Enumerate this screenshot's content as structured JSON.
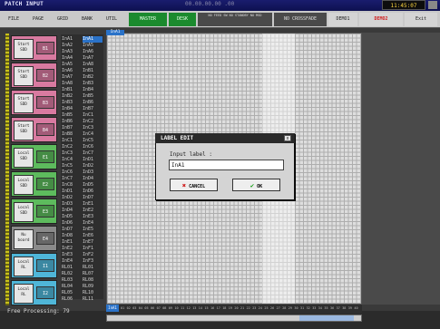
{
  "window": {
    "title": "PATCH INPUT",
    "timecode": "00.00.00.00 .00",
    "clock": "11:45:07"
  },
  "menu": {
    "items": [
      "FILE",
      "PAGE",
      "GRID",
      "BANK",
      "UTIL"
    ]
  },
  "modes": {
    "master": "MASTER",
    "desk": "DESK",
    "status": "NO FEED  SW  NO STANDBY  NO MSD",
    "crossfade": "NO CROSSFADE",
    "demo1": "DEMO1",
    "demo2": "DEMO2",
    "exit": "Exit"
  },
  "cards": [
    {
      "label": "Start\nSDD",
      "btn": "B1",
      "color": "#d87aa0"
    },
    {
      "label": "Start\nSDD",
      "btn": "B2",
      "color": "#d87aa0"
    },
    {
      "label": "Start\nSDD",
      "btn": "B3",
      "color": "#d87aa0"
    },
    {
      "label": "Start\nSDD",
      "btn": "B4",
      "color": "#d87aa0"
    },
    {
      "label": "Local\nSDD",
      "btn": "E1",
      "color": "#5dbb5d"
    },
    {
      "label": "Local\nSDD",
      "btn": "E2",
      "color": "#5dbb5d"
    },
    {
      "label": "Local\nSDD",
      "btn": "E3",
      "color": "#5dbb5d"
    },
    {
      "label": "Nu\nboard",
      "btn": "E4",
      "color": "#8a8a8a"
    },
    {
      "label": "Local\nRL",
      "btn": "I1",
      "color": "#4fb6d8"
    },
    {
      "label": "Local\nRL",
      "btn": "I2",
      "color": "#4fb6d8"
    }
  ],
  "names": {
    "col1": [
      "InA1",
      "InA2",
      "InA3",
      "InA4",
      "InA5",
      "InA6",
      "InA7",
      "InA8",
      "InB1",
      "InB2",
      "InB3",
      "InB4",
      "InB5",
      "InB6",
      "InB7",
      "InB8",
      "InC1",
      "InC2",
      "InC3",
      "InC4",
      "InC5",
      "InC6",
      "InC7",
      "InC8",
      "InD1",
      "InD2",
      "InD3",
      "InD4",
      "InD5",
      "InD6",
      "InD7",
      "InD8",
      "InE1",
      "InE2",
      "InE3",
      "InE4",
      "RL01",
      "RL02",
      "RL03",
      "RL04",
      "RL05",
      "RL06"
    ],
    "col2": [
      "InA1",
      "InA5",
      "InA6",
      "InA7",
      "InA8",
      "InB1",
      "InB2",
      "InB3",
      "InB4",
      "InB5",
      "InB6",
      "InB7",
      "InC1",
      "InC2",
      "InC3",
      "InC4",
      "InC5",
      "InC6",
      "InC7",
      "InD1",
      "InD2",
      "InD3",
      "InD4",
      "InD5",
      "InD6",
      "InD7",
      "InE1",
      "InE2",
      "InE3",
      "InE4",
      "InE5",
      "InE6",
      "InE7",
      "InF1",
      "InF2",
      "InF3",
      "RL01",
      "RL07",
      "RL08",
      "RL09",
      "RL10",
      "RL11"
    ]
  },
  "grid": {
    "tab": "InA1"
  },
  "bottom": {
    "selected": "InA1",
    "labels": [
      "01",
      "02",
      "03",
      "04",
      "05",
      "06",
      "07",
      "08",
      "09",
      "10",
      "11",
      "12",
      "13",
      "14",
      "15",
      "16",
      "17",
      "18",
      "19",
      "20",
      "21",
      "22",
      "23",
      "24",
      "25",
      "26",
      "27",
      "28",
      "29",
      "30",
      "31",
      "32",
      "33",
      "34",
      "35",
      "36",
      "37",
      "38",
      "39",
      "40"
    ]
  },
  "status": {
    "text": "Free Processing: 79"
  },
  "dialog": {
    "title": "LABEL EDIT",
    "close": "x",
    "prompt": "Input label :",
    "value": "InA1",
    "cancel": "CANCEL",
    "ok": "OK"
  }
}
